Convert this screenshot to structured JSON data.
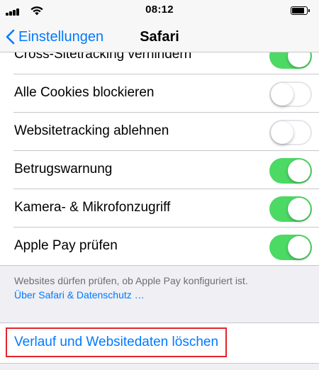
{
  "status_bar": {
    "time": "08:12",
    "battery_level_percent": 85
  },
  "navigation": {
    "back_label": "Einstellungen",
    "title": "Safari"
  },
  "privacy_settings": {
    "items": [
      {
        "label": "Cross-Sitetracking verhindern",
        "enabled": true
      },
      {
        "label": "Alle Cookies blockieren",
        "enabled": false
      },
      {
        "label": "Websitetracking ablehnen",
        "enabled": false
      },
      {
        "label": "Betrugswarnung",
        "enabled": true
      },
      {
        "label": "Kamera- & Mikrofonzugriff",
        "enabled": true
      },
      {
        "label": "Apple Pay prüfen",
        "enabled": true
      }
    ]
  },
  "footer": {
    "note": "Websites dürfen prüfen, ob Apple Pay konfiguriert ist.",
    "link": "Über Safari & Datenschutz …"
  },
  "actions": {
    "clear_history_label": "Verlauf und Websitedaten löschen"
  },
  "colors": {
    "accent": "#007aff",
    "toggle_on": "#4cd964",
    "highlight_border": "#e5242a"
  },
  "icons": {
    "back": "chevron-left-icon",
    "signal": "signal-strength-icon",
    "wifi": "wifi-icon",
    "battery": "battery-icon"
  }
}
